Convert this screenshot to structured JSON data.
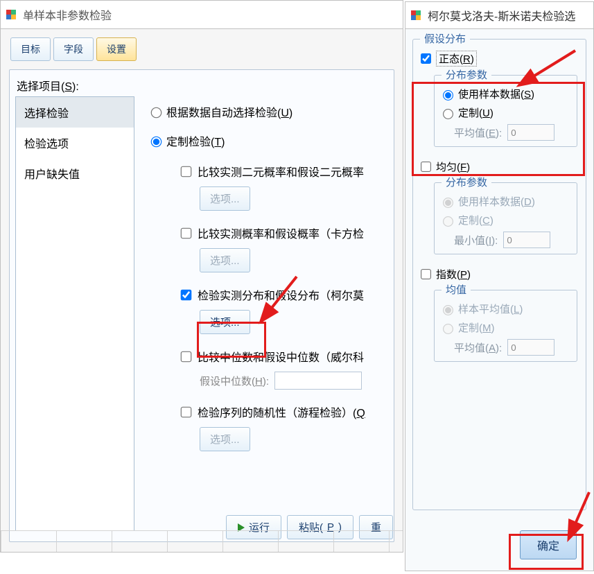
{
  "main": {
    "title": "单样本非参数检验",
    "tabs": [
      "目标",
      "字段",
      "设置"
    ],
    "active_tab": 2,
    "select_label": "选择项目(",
    "select_label_key": "S",
    "select_label_end": "):",
    "list": [
      "选择检验",
      "检验选项",
      "用户缺失值"
    ],
    "selected_item": 0,
    "r1_label": "根据数据自动选择检验(",
    "r1_key": "U",
    "r2_label": "定制检验(",
    "r2_key": "T",
    "chk1": "比较实测二元概率和假设二元概率",
    "chk2": "比较实测概率和假设概率（卡方检",
    "chk3": "检验实测分布和假设分布（柯尔莫",
    "chk4": "比较中位数和假设中位数（威尔科",
    "chk5": "检验序列的随机性（游程检验）(",
    "chk5_key": "Q",
    "options_btn": "选项...",
    "median_label": "假设中位数(",
    "median_key": "H",
    "median_end": "):",
    "run": "运行",
    "paste": "粘贴(",
    "paste_key": "P",
    "reset": "重"
  },
  "dlg": {
    "title": "柯尔莫戈洛夫-斯米诺夫检验选",
    "hypo_legend": "假设分布",
    "normal": "正态(",
    "normal_key": "R",
    "params_legend": "分布参数",
    "use_sample": "使用样本数据(",
    "use_sample_key": "S",
    "custom": "定制(",
    "custom_key": "U",
    "mean_label": "平均值(",
    "mean_key": "E",
    "mean_end": "):",
    "mean_val": "0",
    "uniform": "均匀(",
    "uniform_key": "F",
    "u_use_sample": "使用样本数据(",
    "u_use_sample_key": "D",
    "u_custom": "定制(",
    "u_custom_key": "C",
    "min_label": "最小值(",
    "min_key": "I",
    "min_end": "):",
    "min_val": "0",
    "exp": "指数(",
    "exp_key": "P",
    "e_mean_legend": "均值",
    "e_sample_mean": "样本平均值(",
    "e_sample_mean_key": "L",
    "e_custom": "定制(",
    "e_custom_key": "M",
    "e_mean_label": "平均值(",
    "e_mean_key": "A",
    "e_mean_end": "):",
    "e_mean_val": "0",
    "ok": "确定"
  }
}
